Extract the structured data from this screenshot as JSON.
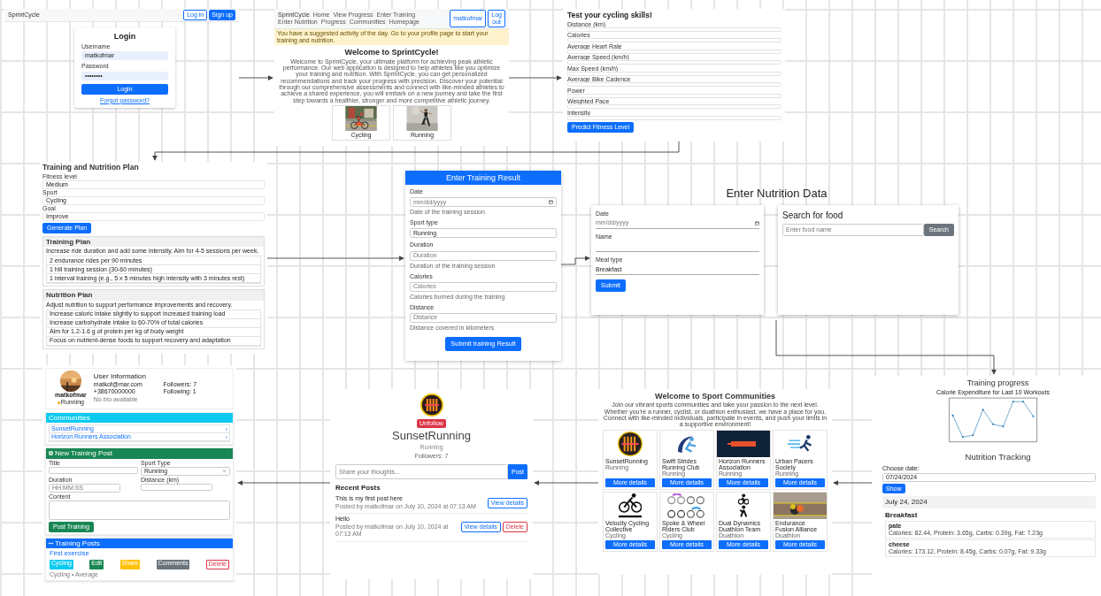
{
  "login": {
    "brand": "SprintCycle",
    "nav_buttons": [
      {
        "label": "Log in",
        "kind": "outline"
      },
      {
        "label": "Sign up",
        "kind": "filled"
      }
    ],
    "title": "Login",
    "fields": [
      {
        "label": "Username",
        "value": "matkofmar"
      },
      {
        "label": "Password",
        "value": "••••••••"
      }
    ],
    "submit": "Login",
    "link": "Forgot password?"
  },
  "home": {
    "brand": "SprintCycle",
    "nav_links": [
      "Home",
      "View Progress",
      "Enter Training",
      "Enter Nutrition",
      "Progress",
      "Communities",
      "Homepage"
    ],
    "nav_buttons": [
      "matkofmar",
      "Log out"
    ],
    "alert": "You have a suggested activity of the day. Go to your profile page to start your training and nutrition.",
    "title": "Welcome to SprintCycle!",
    "intro": "Welcome to SprintCycle, your ultimate platform for achieving peak athletic performance. Our web application is designed to help athletes like you optimize your training and nutrition. With SprintCycle, you can get personalized recommendations and track your progress with precision. Discover your potential through our comprehensive assessments and connect with like-minded athletes to achieve a shared experience, you will embark on a new journey and take the first step towards a healthier, stronger and more competitive athletic journey.",
    "photos": [
      {
        "caption": "Cycling"
      },
      {
        "caption": "Running"
      }
    ]
  },
  "skills_test": {
    "title": "Test your cycling skills!",
    "fields": [
      "Distance (km)",
      "Calories",
      "Average Heart Rate",
      "Average Speed (km/h)",
      "Max Speed (km/h)",
      "Average Bike Cadence",
      "Power",
      "Weighted Pace",
      "Intensity"
    ],
    "submit": "Predict Fitness Level"
  },
  "plan": {
    "title": "Training and Nutrition Plan",
    "fields": [
      {
        "label": "Fitness level",
        "value": "Medium"
      },
      {
        "label": "Sport",
        "value": "Cycling"
      },
      {
        "label": "Goal",
        "value": "Improve"
      }
    ],
    "submit": "Generate Plan",
    "sections": [
      {
        "title": "Training Plan",
        "summary": "Increase ride duration and add some intensity. Aim for 4-5 sessions per week.",
        "items": [
          "2 endurance rides per 90 minutes",
          "1 hill training session (30-60 minutes)",
          "1 interval training (e.g., 5 x 5 minutes high intensity with 3 minutes rest)"
        ]
      },
      {
        "title": "Nutrition Plan",
        "summary": "Adjust nutrition to support performance improvements and recovery.",
        "items": [
          "Increase caloric intake slightly to support increased training load",
          "Increase carbohydrate intake to 60-70% of total calories",
          "Aim for 1.2-1.6 g of protein per kg of body weight",
          "Focus on nutrient-dense foods to support recovery and adaptation"
        ]
      }
    ]
  },
  "training_result": {
    "title": "Enter Training Result",
    "fields": [
      {
        "label": "Date",
        "kind": "date",
        "placeholder": "mm/dd/yyyy",
        "help": "Date of the training session"
      },
      {
        "label": "Sport type",
        "kind": "text",
        "value": "Running"
      },
      {
        "label": "Duration",
        "kind": "text",
        "placeholder": "Duration",
        "help": "Duration of the training session"
      },
      {
        "label": "Calories",
        "kind": "text",
        "placeholder": "Calories",
        "help": "Calories burned during the training"
      },
      {
        "label": "Distance",
        "kind": "text",
        "placeholder": "Distance",
        "help": "Distance covered in kilometers"
      }
    ],
    "submit": "Submit training Result"
  },
  "nutrition": {
    "title": "Enter Nutrition Data",
    "fields": [
      {
        "label": "Date",
        "kind": "date",
        "placeholder": "mm/dd/yyyy"
      },
      {
        "label": "Name",
        "kind": "text"
      },
      {
        "label": "Meal type",
        "kind": "text",
        "value": "Breakfast"
      }
    ],
    "submit": "Submit",
    "search": {
      "title": "Search for food",
      "placeholder": "Enter food name",
      "button": "Search"
    }
  },
  "profile": {
    "username": "matkofmar",
    "badge": "Running",
    "info_title": "User Information",
    "info": [
      "matkof@mar.com",
      "Followers: 7",
      "+38670000000",
      "Following: 1"
    ],
    "bio": "No bio available",
    "communities_title": "Communities",
    "communities": [
      "SunsetRunning",
      "Horizon Runners Association"
    ],
    "new_post": {
      "title": "New Training Post",
      "fields": [
        {
          "label": "Title",
          "kind": "text"
        },
        {
          "label": "Sport Type",
          "kind": "select",
          "value": "Running"
        },
        {
          "label": "Duration",
          "kind": "text",
          "placeholder": "HH:MM:SS"
        },
        {
          "label": "Distance (km)",
          "kind": "text"
        },
        {
          "label": "Content",
          "kind": "area"
        }
      ],
      "submit": "Post Training"
    },
    "posts_title": "Training Posts",
    "post": {
      "title": "First exercise",
      "tags": [
        {
          "label": "Cycling",
          "color": "#0dcaf0",
          "kind": "filled"
        },
        {
          "label": "Edit",
          "color": "#198754",
          "kind": "filled"
        },
        {
          "label": "Share",
          "color": "#ffc107",
          "kind": "filled"
        },
        {
          "label": "Comments",
          "color": "#6c757d",
          "kind": "filled"
        },
        {
          "label": "Delete",
          "color": "#dc3545",
          "kind": "outline"
        }
      ],
      "meta": "Cycling • Average"
    }
  },
  "community": {
    "follow_button": "Unfollow",
    "name": "SunsetRunning",
    "sport": "Running",
    "followers": "Followers: 7",
    "post_placeholder": "Share your thoughts...",
    "post_button": "Post",
    "recent_title": "Recent Posts",
    "posts": [
      {
        "title": "This is my first post here",
        "meta": "Posted by matkofmar on July 10, 2024 at 07:13 AM",
        "buttons": [
          {
            "label": "View details",
            "kind": "outline"
          }
        ]
      },
      {
        "title": "Hello",
        "meta": "Posted by matkofmar on July 10, 2024 at 07:13 AM",
        "buttons": [
          {
            "label": "View details",
            "kind": "outline"
          },
          {
            "label": "Delete",
            "kind": "danger"
          }
        ]
      }
    ]
  },
  "communities": {
    "title": "Welcome to Sport Communities",
    "intro": "Join our vibrant sports communities and take your passion to the next level. Whether you're a runner, cyclist, or duathlon enthusiast, we have a place for you. Connect with like-minded individuals, participate in events, and push your limits in a supportive environment!",
    "cards": [
      {
        "name": "SunsetRunning",
        "sport": "Running",
        "button": "More details"
      },
      {
        "name": "Swift Strides Running Club",
        "sport": "Running",
        "button": "More details"
      },
      {
        "name": "Horizon Runners Association",
        "sport": "Running",
        "button": "More details"
      },
      {
        "name": "Urban Pacers Society",
        "sport": "Running",
        "button": "More details"
      },
      {
        "name": "Velocity Cycling Collective",
        "sport": "Cycling",
        "button": "More details"
      },
      {
        "name": "Spoke & Wheel Riders Club",
        "sport": "Cycling",
        "button": "More details"
      },
      {
        "name": "Dual Dynamics Duathlon Team",
        "sport": "Duathlon",
        "button": "More details"
      },
      {
        "name": "Endurance Fusion Alliance",
        "sport": "Duathlon",
        "button": "More details"
      }
    ]
  },
  "progress": {
    "title": "Training progress",
    "chart_title": "Calorie Expenditure for Last 10 Workouts",
    "nutrition_title": "Nutrition Tracking",
    "date_label": "Choose date:",
    "date_value": "07/24/2024",
    "show_button": "Show",
    "day": "July 24, 2024",
    "meal": "Breakfast",
    "foods": [
      {
        "name": "pate",
        "detail": "Calories: 82.44, Protein: 3.65g, Carbs: 0.39g, Fat: 7.23g"
      },
      {
        "name": "cheese",
        "detail": "Calories: 173.12, Protein: 8.45g, Carbs: 0.07g, Fat: 9.33g"
      }
    ]
  }
}
